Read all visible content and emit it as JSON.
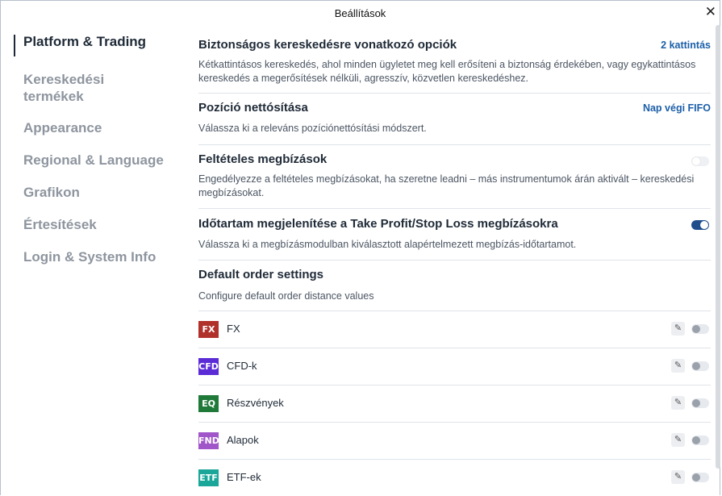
{
  "window": {
    "title": "Beállítások",
    "close_glyph": "✕"
  },
  "sidebar": {
    "items": [
      {
        "label": "Platform & Trading",
        "active": true
      },
      {
        "label": "Kereskedési termékek"
      },
      {
        "label": "Appearance"
      },
      {
        "label": "Regional & Language"
      },
      {
        "label": "Grafikon"
      },
      {
        "label": "Értesítések"
      },
      {
        "label": "Login & System Info"
      }
    ]
  },
  "sections": {
    "safe_trading": {
      "title": "Biztonságos kereskedésre vonatkozó opciók",
      "action": "2 kattintás",
      "desc": "Kétkattintásos kereskedés, ahol minden ügyletet meg kell erősíteni a biztonság érdekében, vagy egykattintásos kereskedés a megerősítések nélküli, agresszív, közvetlen kereskedéshez."
    },
    "position_netting": {
      "title": "Pozíció nettósítása",
      "action": "Nap végi FIFO",
      "desc": "Válassza ki a releváns pozíciónettósítási módszert."
    },
    "conditional_orders": {
      "title": "Feltételes megbízások",
      "desc": "Engedélyezze a feltételes megbízásokat, ha szeretne leadni – más instrumentumok árán aktivált – kereskedési megbízásokat.",
      "enabled": false
    },
    "tp_sl_duration": {
      "title": "Időtartam megjelenítése a Take Profit/Stop Loss megbízásokra",
      "desc": "Válassza ki a megbízásmodulban kiválasztott alapértelmezett megbízás-időtartamot.",
      "enabled": true
    },
    "default_orders": {
      "title": "Default order settings",
      "desc": "Configure default order distance values",
      "edit_glyph": "✎",
      "rows": [
        {
          "badge": "FX",
          "color": "#b0302a",
          "label": "FX",
          "enabled": false
        },
        {
          "badge": "CFD",
          "color": "#5b2bd6",
          "label": "CFD-k",
          "enabled": false
        },
        {
          "badge": "EQ",
          "color": "#1f7a3a",
          "label": "Részvények",
          "enabled": false
        },
        {
          "badge": "FND",
          "color": "#a055c8",
          "label": "Alapok",
          "enabled": false
        },
        {
          "badge": "ETF",
          "color": "#1aa79a",
          "label": "ETF-ek",
          "enabled": false
        }
      ]
    }
  }
}
